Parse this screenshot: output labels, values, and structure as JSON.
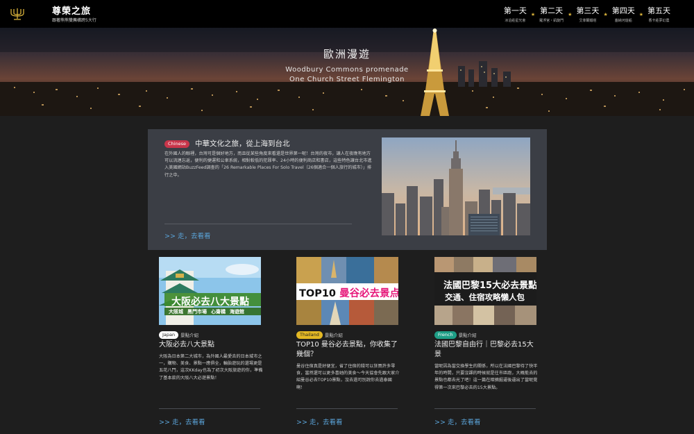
{
  "header": {
    "logo_icon": "candelabra-icon",
    "title": "尊榮之旅",
    "subtitle": "跟著熊熊雙薦橫跨5大行",
    "days": [
      {
        "title": "第一天",
        "sub": "冰泊莊星光會"
      },
      {
        "title": "第二天",
        "sub": "羅浮宮・凱旋門"
      },
      {
        "title": "第三天",
        "sub": "艾菲爾鐵塔"
      },
      {
        "title": "第四天",
        "sub": "塞納河遊船"
      },
      {
        "title": "第五天",
        "sub": "香卡莊夢幻農"
      }
    ],
    "accent": "#d9b23a"
  },
  "hero": {
    "title": "歐洲漫遊",
    "line1": "Woodbury Commons promenade",
    "line2": "One Church Street Flemington"
  },
  "featured": {
    "badge": "Chinese",
    "badge_color": "#c8354a",
    "title": "中華文化之旅，從上海到台北",
    "body": "在外國人的眼裡，台灣可是個好地方，而且從某些角度來看還是世界第一呢！台灣的夜市，讓人在夜晚有地方可以流連忘返，便利的捷運和公車系統，相對較低的犯罪率、24小時的便利商店和書店，這些特色讓台北市進入美國網站BuzzFeed調查的「26 Remarkable Places For Solo Travel（26個適合一個人旅行的城市）」排行之中。",
    "more": ">> 走，去看看",
    "photo_icon": "new-york-skyline-photo"
  },
  "cards": [
    {
      "badge": "Japan",
      "badge_color": "#ffffff",
      "badge_text_color": "#222222",
      "tag_note": "景點介紹",
      "title": "大阪必去八大景點",
      "body": "大阪為日本第二大城市，為外國人最愛去的日本城市之一，購物、美食、景點一應俱全，輪胎遊玩的還場更是五花八門，這次KKday也為了初次大阪旅遊的你，準備了基本款的大阪八大必遊景點！",
      "more": ">> 走，去看看",
      "banner_main": "大阪必去八大景點",
      "banner_tags": [
        "大阪城",
        "黑門市場",
        "心齋橋",
        "海遊館"
      ]
    },
    {
      "badge": "Thailand",
      "badge_color": "#e3b824",
      "badge_text_color": "#222222",
      "tag_note": "景點介紹",
      "title": "TOP10 曼谷必去景點，你收集了幾個？",
      "body": "曼谷住宿真是好便宜，省了住宿的錢可以狂買許多零食，當然還可以更多喜她的美食～今天協會先跟大家介紹曼谷必去TOP10景點，沒去過可別說你去過泰國啊！",
      "more": ">> 走，去看看",
      "banner_main": "TOP10 曼谷必去景点"
    },
    {
      "badge": "French",
      "badge_color": "#1e9e86",
      "badge_text_color": "#ffffff",
      "tag_note": "景點介紹",
      "title": "法國巴黎自由行｜巴黎必去15大景",
      "body": "當呢因為當交換學生的關係，所以在法國巴黎待了快半年的時間，只要沒課的時候就是往市區跑，大概能去的景點也都去光了吧！這一篇在暗摘掘逼後逼出了當呢覺得第一次來巴黎必去的15大景點。",
      "more": ">> 走，去看看",
      "banner_main": "法國巴黎15大必去景點",
      "banner_sub": "交通、住宿攻略懶人包"
    }
  ]
}
